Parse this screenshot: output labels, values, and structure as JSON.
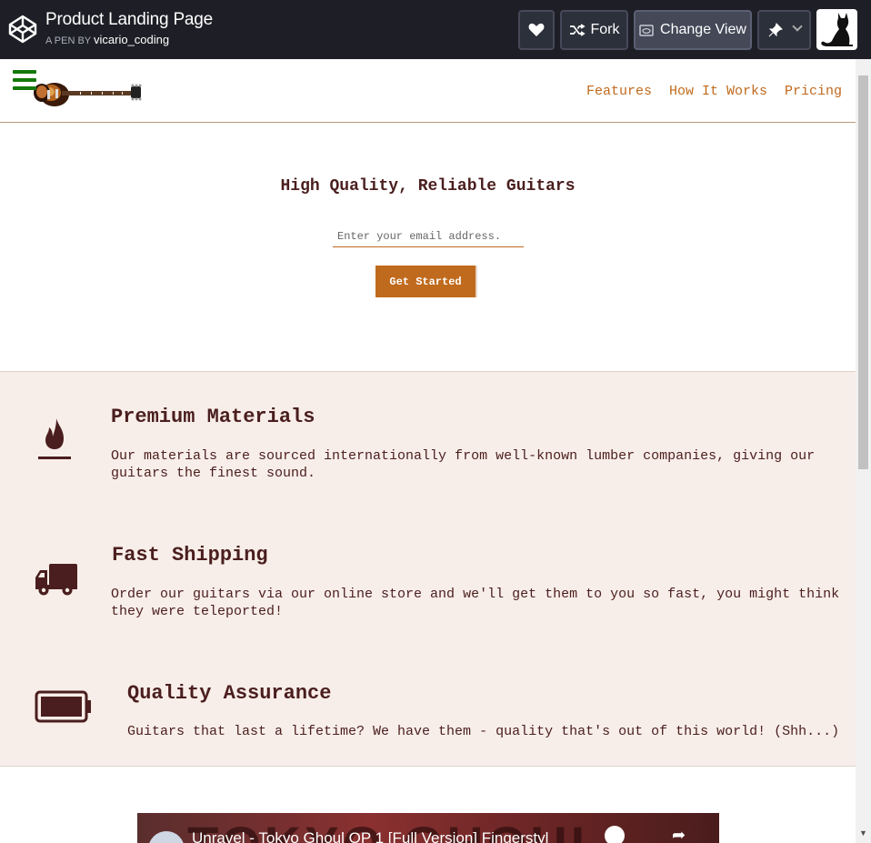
{
  "codepen": {
    "title": "Product Landing Page",
    "by_label": "A PEN BY",
    "author": "vicario_coding",
    "fork_label": "Fork",
    "change_view_label": "Change View"
  },
  "nav": {
    "links": [
      "Features",
      "How It Works",
      "Pricing"
    ]
  },
  "hero": {
    "title": "High Quality, Reliable Guitars",
    "email_placeholder": "Enter your email address.",
    "cta_label": "Get Started"
  },
  "features": [
    {
      "icon": "fire-icon",
      "title": "Premium Materials",
      "lines": [
        "Our materials are sourced internationally from well-known lumber companies, giving our",
        "guitars the finest sound."
      ]
    },
    {
      "icon": "truck-icon",
      "title": "Fast Shipping",
      "lines": [
        "Order our guitars via our online store and we'll get them to you so fast, you might think",
        "they were teleported!"
      ]
    },
    {
      "icon": "battery-icon",
      "title": "Quality Assurance",
      "lines": [
        "Guitars that last a lifetime? We have them - quality that's out of this world! (Shh...)"
      ]
    }
  ],
  "video": {
    "title": "Unravel - Tokyo Ghoul OP 1 [Full Version] Fingerstyl",
    "background_text": "TOKYO GHOUL"
  },
  "colors": {
    "accent": "#c06a1d",
    "text": "#4a1e1e",
    "section_bg": "#f8eee9",
    "codepen_bar": "#1e1f26"
  }
}
